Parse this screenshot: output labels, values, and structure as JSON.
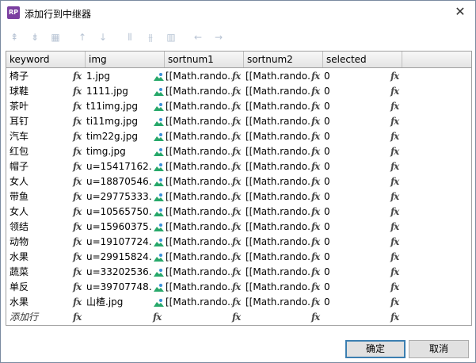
{
  "window": {
    "title": "添加行到中继器",
    "app_icon_text": "RP",
    "close_glyph": "✕"
  },
  "toolbar": {
    "buttons": [
      {
        "name": "insert-row-above-icon",
        "glyph": "⇞"
      },
      {
        "name": "insert-row-below-icon",
        "glyph": "⇟"
      },
      {
        "name": "delete-row-icon",
        "glyph": "▦"
      },
      {
        "name": "move-up-icon",
        "glyph": "↑"
      },
      {
        "name": "move-down-icon",
        "glyph": "↓"
      },
      {
        "name": "insert-column-left-icon",
        "glyph": "⫴"
      },
      {
        "name": "insert-column-right-icon",
        "glyph": "⫵"
      },
      {
        "name": "delete-column-icon",
        "glyph": "▥"
      },
      {
        "name": "move-left-icon",
        "glyph": "←"
      },
      {
        "name": "move-right-icon",
        "glyph": "→"
      }
    ]
  },
  "grid": {
    "columns": [
      "keyword",
      "img",
      "sortnum1",
      "sortnum2",
      "selected"
    ],
    "rows": [
      {
        "keyword": "椅子",
        "img": "1.jpg",
        "sortnum1": "[[Math.rando…",
        "sortnum2": "0"
      },
      {
        "keyword": "球鞋",
        "img": "1111.jpg",
        "sortnum1": "[[Math.rando…",
        "sortnum2": "0"
      },
      {
        "keyword": "茶叶",
        "img": "t11img.jpg",
        "sortnum1": "[[Math.rando…",
        "sortnum2": "0"
      },
      {
        "keyword": "耳钉",
        "img": "ti11mg.jpg",
        "sortnum1": "[[Math.rando…",
        "sortnum2": "0"
      },
      {
        "keyword": "汽车",
        "img": "tim22g.jpg",
        "sortnum1": "[[Math.rando…",
        "sortnum2": "0"
      },
      {
        "keyword": "红包",
        "img": "timg.jpg",
        "sortnum1": "[[Math.rando…",
        "sortnum2": "0"
      },
      {
        "keyword": "帽子",
        "img": "u=15417162…",
        "sortnum1": "[[Math.rando…",
        "sortnum2": "0"
      },
      {
        "keyword": "女人",
        "img": "u=18870546…",
        "sortnum1": "[[Math.rando…",
        "sortnum2": "0"
      },
      {
        "keyword": "带鱼",
        "img": "u=29775333…",
        "sortnum1": "[[Math.rando…",
        "sortnum2": "0"
      },
      {
        "keyword": "女人",
        "img": "u=10565750…",
        "sortnum1": "[[Math.rando…",
        "sortnum2": "0"
      },
      {
        "keyword": "领结",
        "img": "u=15960375…",
        "sortnum1": "[[Math.rando…",
        "sortnum2": "0"
      },
      {
        "keyword": "动物",
        "img": "u=19107724…",
        "sortnum1": "[[Math.rando…",
        "sortnum2": "0"
      },
      {
        "keyword": "水果",
        "img": "u=29915824…",
        "sortnum1": "[[Math.rando…",
        "sortnum2": "0"
      },
      {
        "keyword": "蔬菜",
        "img": "u=33202536…",
        "sortnum1": "[[Math.rando…",
        "sortnum2": "0"
      },
      {
        "keyword": "单反",
        "img": "u=39707748…",
        "sortnum1": "[[Math.rando…",
        "sortnum2": "0"
      },
      {
        "keyword": "水果",
        "img": "山楂.jpg",
        "sortnum1": "[[Math.rando…",
        "sortnum2": "0"
      }
    ],
    "add_row_label": "添加行",
    "fx_label": "fx"
  },
  "buttons": {
    "ok_label": "确定",
    "cancel_label": "取消"
  },
  "colors": {
    "app_icon": "#7b3fa0",
    "img_icon_sky": "#3a8fd8",
    "img_icon_land": "#27a86a",
    "ok_border": "#3c7fb1"
  }
}
